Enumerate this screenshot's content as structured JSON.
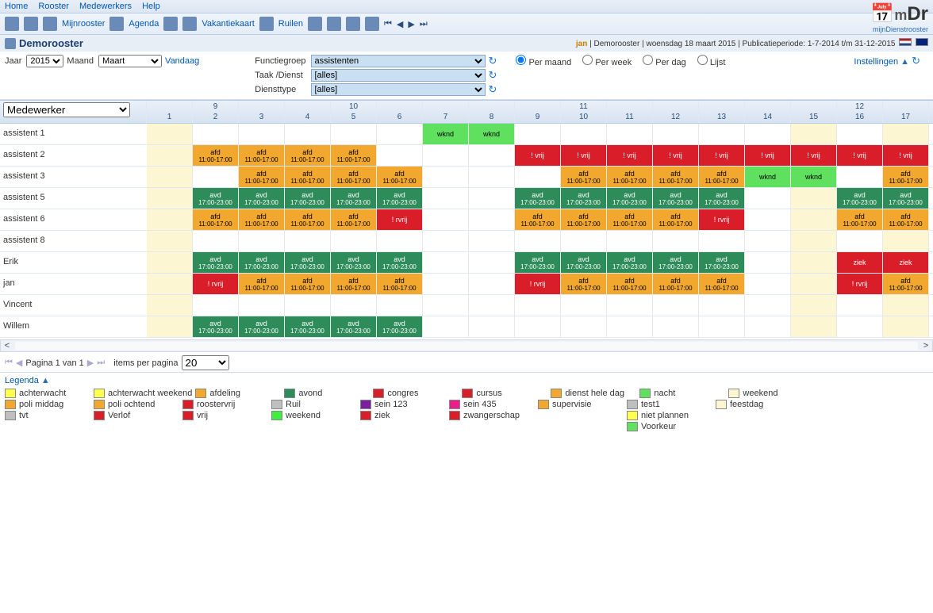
{
  "menu": {
    "home": "Home",
    "rooster": "Rooster",
    "medewerkers": "Medewerkers",
    "help": "Help"
  },
  "toolbar": {
    "mijnrooster": "Mijnrooster",
    "agenda": "Agenda",
    "vakantiekaart": "Vakantiekaart",
    "ruilen": "Ruilen"
  },
  "logo": {
    "main_prefix": "m",
    "main_rest": "Dr",
    "sub": "mijnDienstrooster"
  },
  "subheader": {
    "title": "Demorooster",
    "user": "jan",
    "loc": "Demorooster",
    "date": "woensdag 18 maart 2015",
    "period_label": "Publicatieperiode:",
    "period": "1-7-2014 t/m 31-12-2015"
  },
  "controls": {
    "jaar_label": "Jaar",
    "jaar_value": "2015",
    "maand_label": "Maand",
    "maand_value": "Maart",
    "vandaag": "Vandaag",
    "functiegroep_label": "Functiegroep",
    "functiegroep_value": "assistenten",
    "taak_label": "Taak /Dienst",
    "taak_value": "[alles]",
    "diensttype_label": "Diensttype",
    "diensttype_value": "[alles]",
    "per_maand": "Per maand",
    "per_week": "Per week",
    "per_dag": "Per dag",
    "lijst": "Lijst",
    "instellingen": "Instellingen"
  },
  "medewerker_label": "Medewerker",
  "pager": {
    "text": "Pagina 1 van 1",
    "items_label": "items per pagina",
    "items_value": "20"
  },
  "legend_label": "Legenda",
  "chart_data": {
    "type": "table",
    "title": "Demorooster",
    "week_numbers": [
      "",
      "9",
      "",
      "",
      "10",
      "",
      "",
      "",
      "",
      "11",
      "",
      "",
      "",
      "",
      "",
      "12",
      ""
    ],
    "days": [
      "1",
      "2",
      "3",
      "4",
      "5",
      "6",
      "7",
      "8",
      "9",
      "10",
      "11",
      "12",
      "13",
      "14",
      "15",
      "16",
      "17"
    ],
    "shifts": {
      "afd": {
        "label": "afd",
        "time": "11:00-17:00",
        "class": "c-afd"
      },
      "avd": {
        "label": "avd",
        "time": "17:00-23:00",
        "class": "c-avd"
      },
      "vrij": {
        "label": "! vrij",
        "time": "",
        "class": "c-vrij"
      },
      "wknd": {
        "label": "wknd",
        "time": "",
        "class": "c-wknd"
      },
      "rvrij": {
        "label": "! rvrij",
        "time": "",
        "class": "c-rvrij"
      },
      "ziek": {
        "label": "ziek",
        "time": "",
        "class": "c-ziek"
      },
      "yel": {
        "label": "",
        "time": "",
        "class": "c-yel"
      },
      "": {
        "label": "",
        "time": "",
        "class": "c-empty"
      }
    },
    "employees": [
      {
        "name": "assistent 1",
        "cells": [
          "yel",
          "",
          "",
          "",
          "",
          "",
          "wknd",
          "wknd",
          "",
          "",
          "",
          "",
          "",
          "",
          "yel",
          "",
          "yel"
        ]
      },
      {
        "name": "assistent 2",
        "cells": [
          "yel",
          "afd",
          "afd",
          "afd",
          "afd",
          "",
          "",
          "",
          "vrij",
          "vrij",
          "vrij",
          "vrij",
          "vrij",
          "vrij",
          "vrij",
          "vrij",
          "vrij"
        ]
      },
      {
        "name": "assistent 3",
        "cells": [
          "yel",
          "",
          "afd",
          "afd",
          "afd",
          "afd",
          "",
          "",
          "",
          "afd",
          "afd",
          "afd",
          "afd",
          "wknd",
          "wknd",
          "",
          "afd"
        ]
      },
      {
        "name": "assistent 5",
        "cells": [
          "yel",
          "avd",
          "avd",
          "avd",
          "avd",
          "avd",
          "",
          "",
          "avd",
          "avd",
          "avd",
          "avd",
          "avd",
          "",
          "yel",
          "avd",
          "avd"
        ]
      },
      {
        "name": "assistent 6",
        "cells": [
          "yel",
          "afd",
          "afd",
          "afd",
          "afd",
          "rvrij",
          "",
          "",
          "afd",
          "afd",
          "afd",
          "afd",
          "rvrij",
          "",
          "yel",
          "afd",
          "afd"
        ]
      },
      {
        "name": "assistent 8",
        "cells": [
          "yel",
          "",
          "",
          "",
          "",
          "",
          "",
          "",
          "",
          "",
          "",
          "",
          "",
          "",
          "yel",
          "",
          "yel"
        ]
      },
      {
        "name": "Erik",
        "cells": [
          "yel",
          "avd",
          "avd",
          "avd",
          "avd",
          "avd",
          "",
          "",
          "avd",
          "avd",
          "avd",
          "avd",
          "avd",
          "",
          "yel",
          "ziek",
          "ziek"
        ]
      },
      {
        "name": "jan",
        "cells": [
          "yel",
          "rvrij",
          "afd",
          "afd",
          "afd",
          "afd",
          "",
          "",
          "rvrij",
          "afd",
          "afd",
          "afd",
          "afd",
          "",
          "yel",
          "rvrij",
          "afd"
        ]
      },
      {
        "name": "Vincent",
        "cells": [
          "yel",
          "",
          "",
          "",
          "",
          "",
          "",
          "",
          "",
          "",
          "",
          "",
          "",
          "",
          "yel",
          "",
          "yel"
        ]
      },
      {
        "name": "Willem",
        "cells": [
          "yel",
          "avd",
          "avd",
          "avd",
          "avd",
          "avd",
          "",
          "",
          "",
          "",
          "",
          "",
          "",
          "",
          "yel",
          "",
          "yel"
        ]
      }
    ]
  },
  "legend": [
    [
      {
        "color": "#ffff4d",
        "label": "achterwacht"
      },
      {
        "color": "#ffff4d",
        "label": "achterwacht weekend"
      },
      {
        "color": "#f2a82e",
        "label": "afdeling"
      },
      {
        "color": "#2e8b5a",
        "label": "avond"
      },
      {
        "color": "#d91e2a",
        "label": "congres"
      },
      {
        "color": "#d91e2a",
        "label": "cursus"
      },
      {
        "color": "#f2a82e",
        "label": "dienst hele dag"
      },
      {
        "color": "#5fe05f",
        "label": "nacht"
      },
      {
        "color": "#fdf6d3",
        "label": "weekend"
      }
    ],
    [
      {
        "color": "#f2a82e",
        "label": "poli middag"
      },
      {
        "color": "#f2a82e",
        "label": "poli ochtend"
      },
      {
        "color": "#d91e2a",
        "label": "roostervrij"
      },
      {
        "color": "#bfbfbf",
        "label": "Ruil"
      },
      {
        "color": "#7a1fa2",
        "label": "sein 123"
      },
      {
        "color": "#e91e8c",
        "label": "sein 435"
      },
      {
        "color": "#f2a82e",
        "label": "supervisie"
      },
      {
        "color": "#bfbfbf",
        "label": "test1"
      },
      {
        "color": "#fdf6d3",
        "label": "feestdag"
      }
    ],
    [
      {
        "color": "#bfbfbf",
        "label": "tvt"
      },
      {
        "color": "#d91e2a",
        "label": "Verlof"
      },
      {
        "color": "#d91e2a",
        "label": "vrij"
      },
      {
        "color": "#3ef03e",
        "label": "weekend"
      },
      {
        "color": "#d91e2a",
        "label": "ziek"
      },
      {
        "color": "#d91e2a",
        "label": "zwangerschap"
      },
      {
        "color": "",
        "label": ""
      },
      {
        "color": "#ffff4d",
        "label": "niet plannen"
      }
    ],
    [
      {
        "color": "",
        "label": ""
      },
      {
        "color": "",
        "label": ""
      },
      {
        "color": "",
        "label": ""
      },
      {
        "color": "",
        "label": ""
      },
      {
        "color": "",
        "label": ""
      },
      {
        "color": "",
        "label": ""
      },
      {
        "color": "",
        "label": ""
      },
      {
        "color": "#5fe05f",
        "label": "Voorkeur"
      }
    ]
  ]
}
